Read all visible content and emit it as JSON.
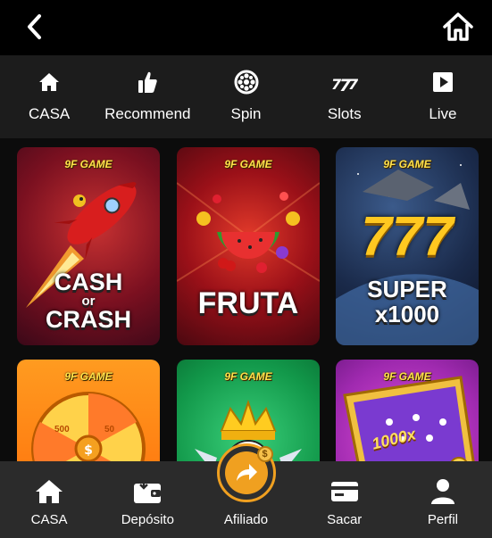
{
  "topbar": {
    "back_icon": "chevron-left-icon",
    "home_icon": "home-outline-icon"
  },
  "categories": [
    {
      "label": "CASA",
      "icon": "home-icon"
    },
    {
      "label": "Recommend",
      "icon": "thumbs-up-icon"
    },
    {
      "label": "Spin",
      "icon": "roulette-wheel-icon"
    },
    {
      "label": "Slots",
      "icon": "slot-777-icon"
    },
    {
      "label": "Live",
      "icon": "play-icon"
    }
  ],
  "games": [
    {
      "brand": "9F GAME",
      "title_line1": "CASH",
      "title_line2": "or",
      "title_line3": "CRASH"
    },
    {
      "brand": "9F GAME",
      "title": "FRUTA"
    },
    {
      "brand": "9F GAME",
      "big": "777",
      "title_line1": "SUPER",
      "title_line2": "x1000"
    },
    {
      "brand": "9F GAME",
      "wheel_labels": [
        "500",
        "50",
        "500",
        "50"
      ]
    },
    {
      "brand": "9F GAME"
    },
    {
      "brand": "9F GAME",
      "badge": "1000x"
    }
  ],
  "bottom_nav": [
    {
      "label": "CASA",
      "icon": "home-icon"
    },
    {
      "label": "Depósito",
      "icon": "wallet-icon"
    },
    {
      "label": "Afiliado",
      "icon": "share-arrow-icon",
      "coin": "$"
    },
    {
      "label": "Sacar",
      "icon": "card-withdraw-icon"
    },
    {
      "label": "Perfil",
      "icon": "user-icon"
    }
  ],
  "colors": {
    "accent": "#f0a020",
    "topbar": "#000000",
    "catbar": "#1c1c1c",
    "bottombar": "#2b2b2b"
  }
}
